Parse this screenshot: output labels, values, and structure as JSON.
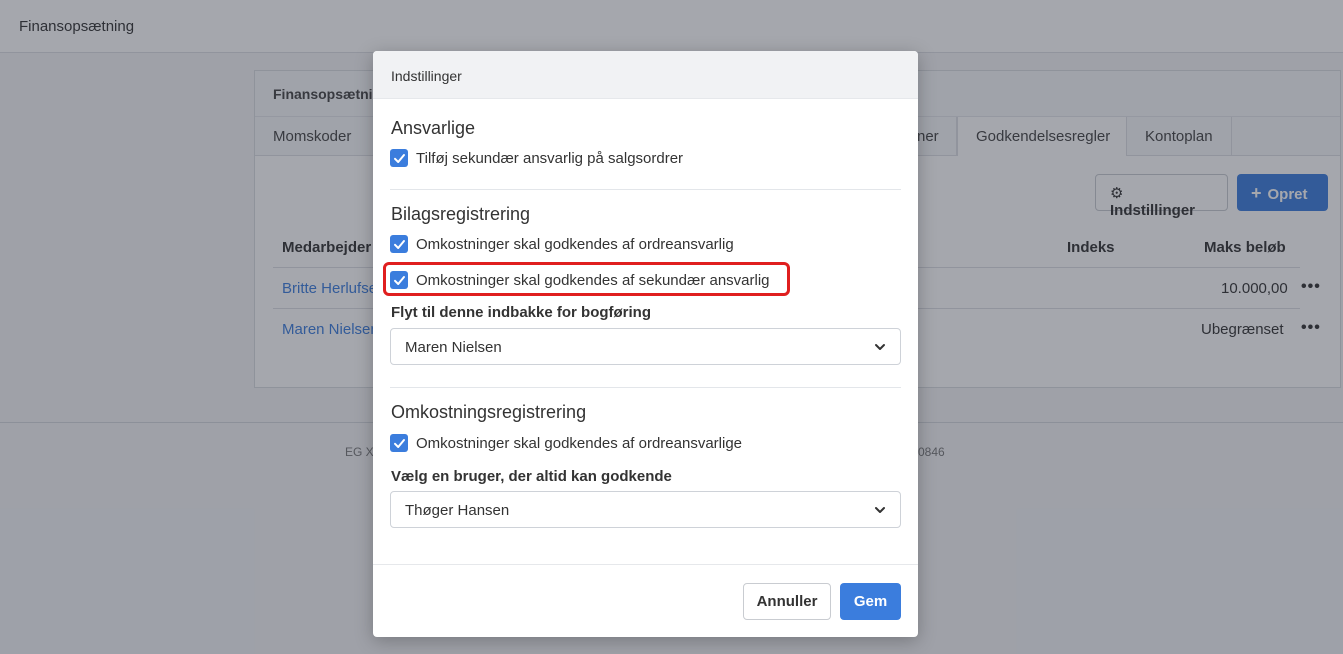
{
  "page": {
    "header_title": "Finansopsætning",
    "card_title": "Finansopsætning",
    "tabs": [
      {
        "label": "Momskoder"
      },
      {
        "label": "ner"
      },
      {
        "label": "Godkendelsesregler"
      },
      {
        "label": "Kontoplan"
      }
    ],
    "settings_button": "Indstillinger",
    "create_button": "Opret",
    "columns": {
      "employee": "Medarbejder",
      "index": "Indeks",
      "max_amount": "Maks beløb"
    },
    "rows": [
      {
        "name": "Britte Herlufse",
        "max_amount": "10.000,00"
      },
      {
        "name": "Maren Nielsen",
        "max_amount": "Ubegrænset"
      }
    ],
    "footer_left": "EG X",
    "footer_right": "0846"
  },
  "modal": {
    "title": "Indstillinger",
    "sections": {
      "responsible": {
        "title": "Ansvarlige",
        "checkbox": {
          "label": "Tilføj sekundær ansvarlig på salgsordrer",
          "checked": true
        }
      },
      "voucher": {
        "title": "Bilagsregistrering",
        "checkbox_1": {
          "label": "Omkostninger skal godkendes af ordreansvarlig",
          "checked": true
        },
        "checkbox_2": {
          "label": "Omkostninger skal godkendes af sekundær ansvarlig",
          "checked": true
        },
        "inbox_label": "Flyt til denne indbakke for bogføring",
        "inbox_value": "Maren Nielsen"
      },
      "expense": {
        "title": "Omkostningsregistrering",
        "checkbox": {
          "label": "Omkostninger skal godkendes af ordreansvarlige",
          "checked": true
        },
        "approver_label": "Vælg en bruger, der altid kan godkende",
        "approver_value": "Thøger Hansen"
      }
    },
    "cancel_button": "Annuller",
    "save_button": "Gem"
  },
  "colors": {
    "accent": "#3b7ddd",
    "highlight": "#e01f1f"
  }
}
